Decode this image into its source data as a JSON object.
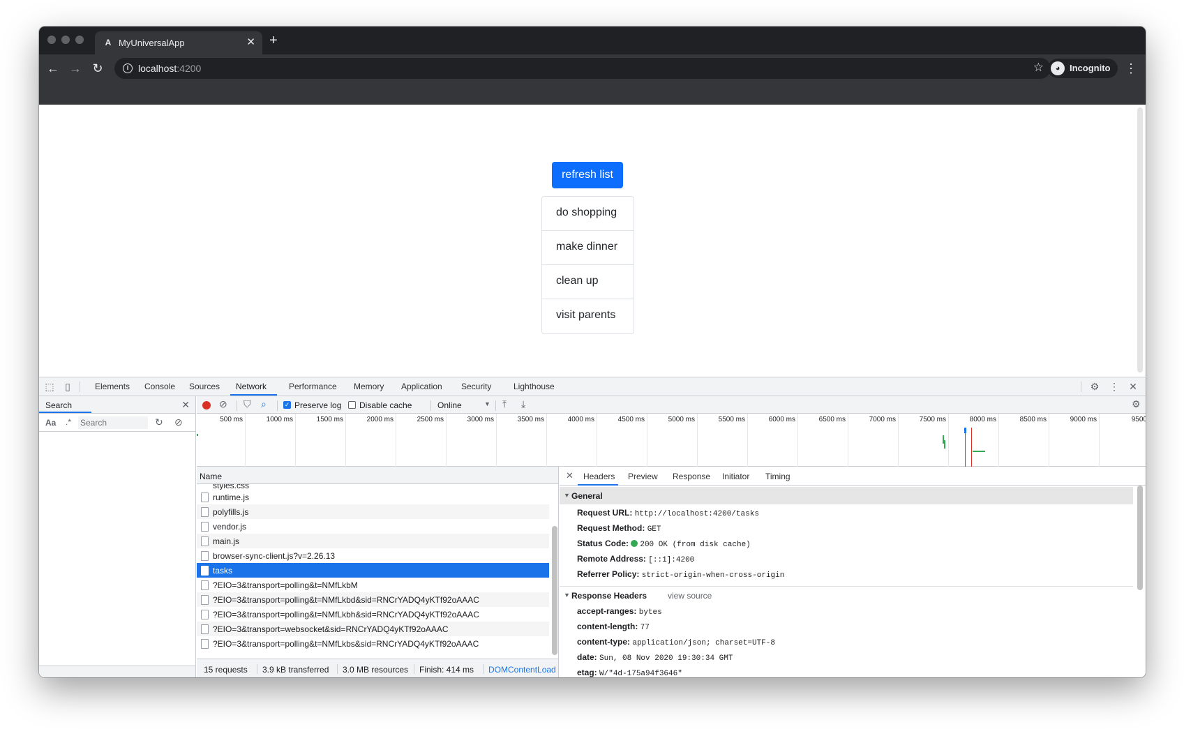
{
  "browser": {
    "tab_title": "MyUniversalApp",
    "tab_favicon": "angular-icon",
    "url_host": "localhost",
    "url_port": ":4200",
    "incognito_label": "Incognito"
  },
  "page": {
    "refresh_label": "refresh list",
    "todos": [
      "do shopping",
      "make dinner",
      "clean up",
      "visit parents"
    ],
    "accent_color": "#0d6efd"
  },
  "devtools": {
    "tabs": [
      "Elements",
      "Console",
      "Sources",
      "Network",
      "Performance",
      "Memory",
      "Application",
      "Security",
      "Lighthouse"
    ],
    "active_tab": "Network",
    "search": {
      "title": "Search",
      "aa": "Aa",
      "regex": ".*",
      "placeholder": "Search"
    },
    "network": {
      "preserve_log_label": "Preserve log",
      "preserve_log": true,
      "disable_cache_label": "Disable cache",
      "disable_cache": false,
      "throttling": "Online",
      "timeline_ticks": [
        "500 ms",
        "1000 ms",
        "1500 ms",
        "2000 ms",
        "2500 ms",
        "3000 ms",
        "3500 ms",
        "4000 ms",
        "4500 ms",
        "5000 ms",
        "5500 ms",
        "6000 ms",
        "6500 ms",
        "7000 ms",
        "7500 ms",
        "8000 ms",
        "8500 ms",
        "9000 ms",
        "9500"
      ],
      "name_header": "Name",
      "partial_top_row": "styles.css",
      "requests": [
        "runtime.js",
        "polyfills.js",
        "vendor.js",
        "main.js",
        "browser-sync-client.js?v=2.26.13",
        "tasks",
        "?EIO=3&transport=polling&t=NMfLkbM",
        "?EIO=3&transport=polling&t=NMfLkbd&sid=RNCrYADQ4yKTf92oAAAC",
        "?EIO=3&transport=polling&t=NMfLkbh&sid=RNCrYADQ4yKTf92oAAAC",
        "?EIO=3&transport=websocket&sid=RNCrYADQ4yKTf92oAAAC",
        "?EIO=3&transport=polling&t=NMfLkbs&sid=RNCrYADQ4yKTf92oAAAC"
      ],
      "selected_request": "tasks",
      "summary": {
        "requests": "15 requests",
        "transferred": "3.9 kB transferred",
        "resources": "3.0 MB resources",
        "finish": "Finish: 414 ms",
        "domcontent": "DOMContentLoad"
      }
    },
    "details": {
      "tabs": [
        "Headers",
        "Preview",
        "Response",
        "Initiator",
        "Timing"
      ],
      "active_tab": "Headers",
      "general_title": "General",
      "general": [
        {
          "key": "Request URL:",
          "value": "http://localhost:4200/tasks"
        },
        {
          "key": "Request Method:",
          "value": "GET"
        },
        {
          "key": "Status Code:",
          "value": "200 OK (from disk cache)"
        },
        {
          "key": "Remote Address:",
          "value": "[::1]:4200"
        },
        {
          "key": "Referrer Policy:",
          "value": "strict-origin-when-cross-origin"
        }
      ],
      "response_headers_title": "Response Headers",
      "view_source": "view source",
      "response_headers": [
        {
          "key": "accept-ranges:",
          "value": "bytes"
        },
        {
          "key": "content-length:",
          "value": "77"
        },
        {
          "key": "content-type:",
          "value": "application/json; charset=UTF-8"
        },
        {
          "key": "date:",
          "value": "Sun, 08 Nov 2020 19:30:34 GMT"
        },
        {
          "key": "etag:",
          "value": "W/\"4d-175a94f3646\""
        }
      ],
      "status_color": "#34a853"
    }
  }
}
